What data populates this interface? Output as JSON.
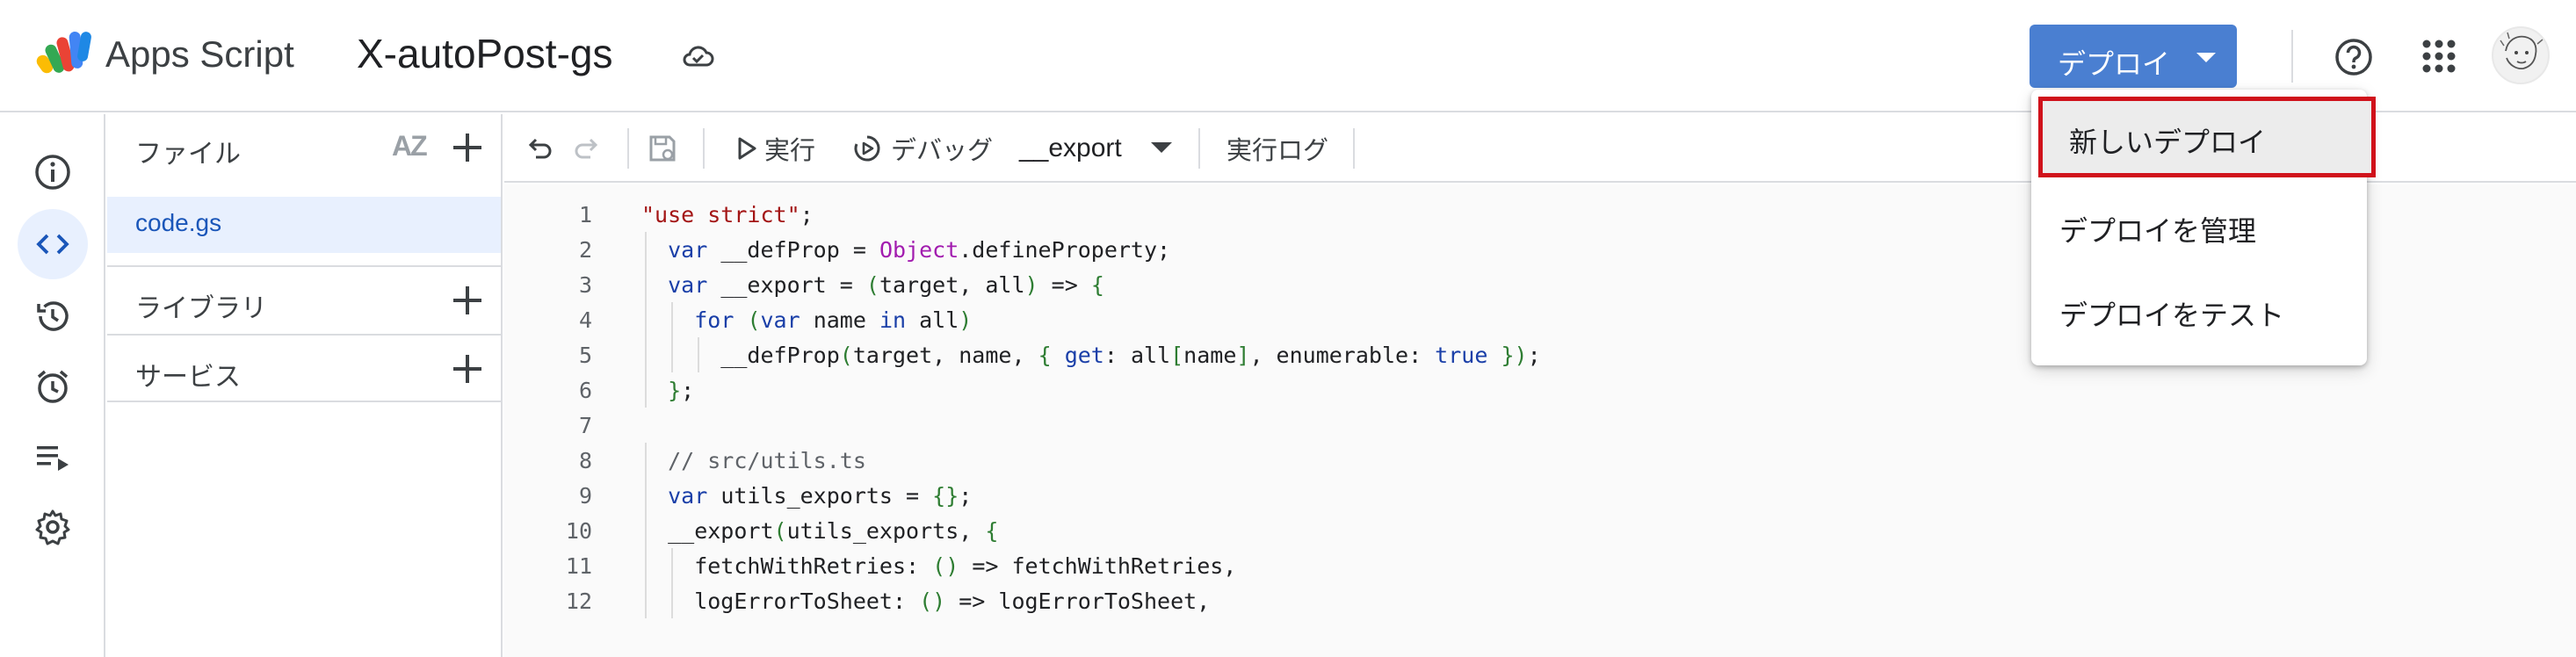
{
  "header": {
    "app_name": "Apps Script",
    "project_title": "X-autoPost-gs",
    "deploy_label": "デプロイ"
  },
  "deploy_menu": {
    "items": [
      "新しいデプロイ",
      "デプロイを管理",
      "デプロイをテスト"
    ],
    "highlight_color": "#d0121b"
  },
  "rail": {
    "icons": [
      "info-icon",
      "code-icon",
      "history-icon",
      "alarm-icon",
      "executions-icon",
      "gear-icon"
    ],
    "active": "code-icon"
  },
  "files_panel": {
    "title": "ファイル",
    "sort_label": "AZ",
    "files": [
      "code.gs"
    ],
    "sections": [
      "ライブラリ",
      "サービス"
    ]
  },
  "toolbar": {
    "run_label": "実行",
    "debug_label": "デバッグ",
    "function_name": "__export",
    "log_label": "実行ログ"
  },
  "editor": {
    "lines": [
      {
        "n": "1",
        "code": "\"use strict\";"
      },
      {
        "n": "2",
        "code": "  var __defProp = Object.defineProperty;"
      },
      {
        "n": "3",
        "code": "  var __export = (target, all) => {"
      },
      {
        "n": "4",
        "code": "    for (var name in all)"
      },
      {
        "n": "5",
        "code": "      __defProp(target, name, { get: all[name], enumerable: true });"
      },
      {
        "n": "6",
        "code": "  };"
      },
      {
        "n": "7",
        "code": ""
      },
      {
        "n": "8",
        "code": "  // src/utils.ts"
      },
      {
        "n": "9",
        "code": "  var utils_exports = {};"
      },
      {
        "n": "10",
        "code": "  __export(utils_exports, {"
      },
      {
        "n": "11",
        "code": "    fetchWithRetries: () => fetchWithRetries,"
      },
      {
        "n": "12",
        "code": "    logErrorToSheet: () => logErrorToSheet,"
      }
    ]
  },
  "colors": {
    "accent": "#4a7fd1",
    "active_bg": "#e8f0fe",
    "file_text": "#1a56b9"
  }
}
